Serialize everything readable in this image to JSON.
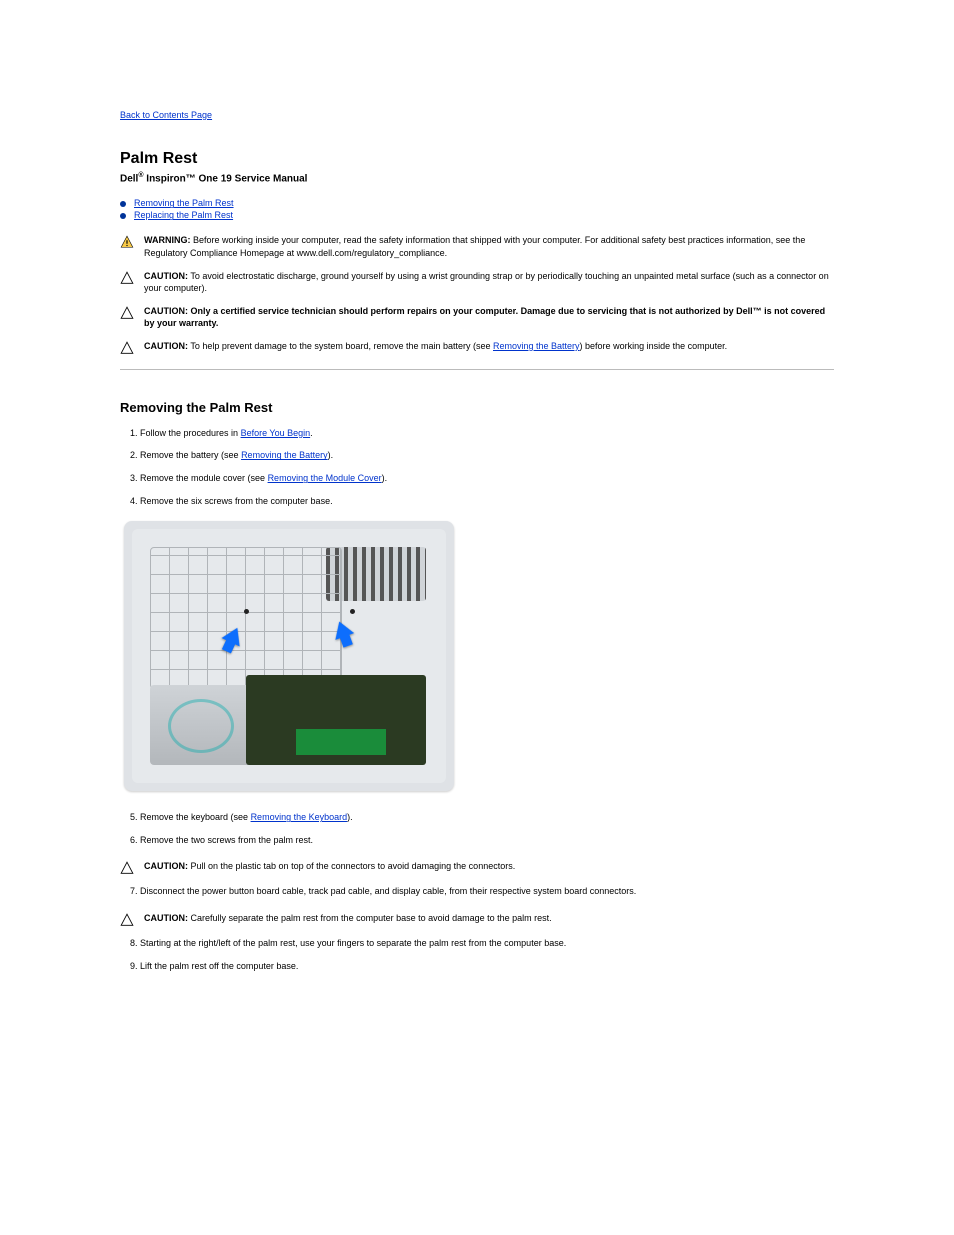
{
  "nav": {
    "back": "Back to Contents Page"
  },
  "header": {
    "title": "Palm Rest",
    "subtitle_pre": "Dell",
    "subtitle_post": " Inspiron™ One 19 Service Manual"
  },
  "toc": {
    "remove": "Removing the Palm Rest",
    "replace": "Replacing the Palm Rest"
  },
  "notices": {
    "warning_label": "WARNING:",
    "warning_body": " Before working inside your computer, read the safety information that shipped with your computer. For additional safety best practices information, see the Regulatory Compliance Homepage at www.dell.com/regulatory_compliance.",
    "caution1_label": "CAUTION:",
    "caution1_body": " To avoid electrostatic discharge, ground yourself by using a wrist grounding strap or by periodically touching an unpainted metal surface (such as a connector on your computer).",
    "caution2_label": "CAUTION:",
    "caution2_body_pre": " Only a certified service technician should perform repairs on your computer. Damage due to servicing that is not authorized by Dell™",
    "caution2_body_post": " is not covered by your warranty.",
    "caution3_label": "CAUTION:",
    "caution3_body_pre": " To help prevent damage to the system board, remove the main battery (see ",
    "caution3_link": "Removing the Battery",
    "caution3_body_post": ") before working inside the computer."
  },
  "remove": {
    "heading": "Removing the Palm Rest",
    "steps": {
      "s1_pre": "Follow the procedures in ",
      "s1_link": "Before You Begin",
      "s1_post": ".",
      "s2_pre": "Remove the battery (see ",
      "s2_link": "Removing the Battery",
      "s2_post": ").",
      "s3_pre": "Remove the module cover (see ",
      "s3_link": "Removing the Module Cover",
      "s3_post": ").",
      "s4": "Remove the six screws from the computer base."
    }
  },
  "remove2": {
    "steps": {
      "s5_pre": "Remove the keyboard (see ",
      "s5_link": "Removing the Keyboard",
      "s5_post": ").",
      "s6": "Remove the two screws from the palm rest.",
      "caut4_label": "CAUTION:",
      "caut4_body": " Pull on the plastic tab on top of the connectors to avoid damaging the connectors.",
      "s7": "Disconnect the power button board cable, track pad cable, and display cable, from their respective system board connectors.",
      "caut5_label": "CAUTION:",
      "caut5_body": " Carefully separate the palm rest from the computer base to avoid damage to the palm rest.",
      "s8": "Starting at the right/left of the palm rest, use your fingers to separate the palm rest from the computer base.",
      "s9": "Lift the palm rest off the computer base."
    }
  }
}
